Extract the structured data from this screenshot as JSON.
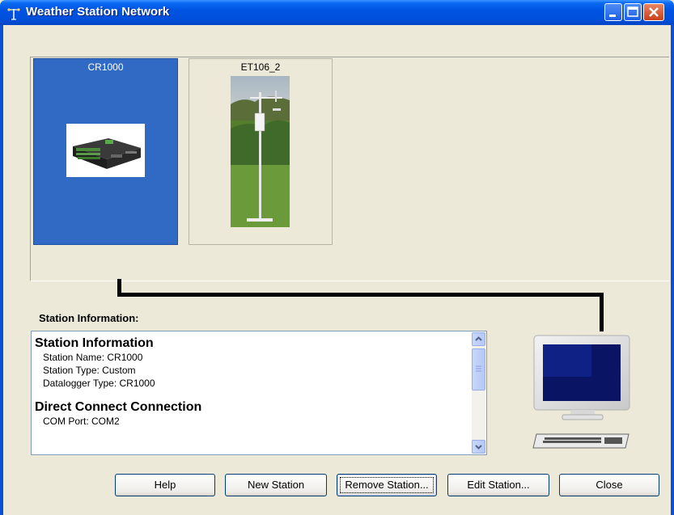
{
  "window": {
    "title": "Weather Station Network",
    "controls": [
      "minimize-icon",
      "maximize-icon",
      "close-icon"
    ]
  },
  "stations": [
    {
      "name": "CR1000",
      "selected": true
    },
    {
      "name": "ET106_2",
      "selected": false
    }
  ],
  "station_info": {
    "label": "Station Information:",
    "sections": [
      {
        "heading": "Station Information",
        "lines": [
          "Station Name: CR1000",
          "Station Type: Custom",
          "Datalogger Type: CR1000"
        ]
      },
      {
        "heading": "Direct Connect Connection",
        "lines": [
          "COM Port: COM2"
        ]
      }
    ]
  },
  "buttons": {
    "help": "Help",
    "new_station": "New Station",
    "remove_station": "Remove Station...",
    "edit_station": "Edit Station...",
    "close": "Close"
  },
  "colors": {
    "selected_tile": "#316ac5",
    "titlebar": "#0053e1",
    "window_bg": "#ece9d8"
  }
}
